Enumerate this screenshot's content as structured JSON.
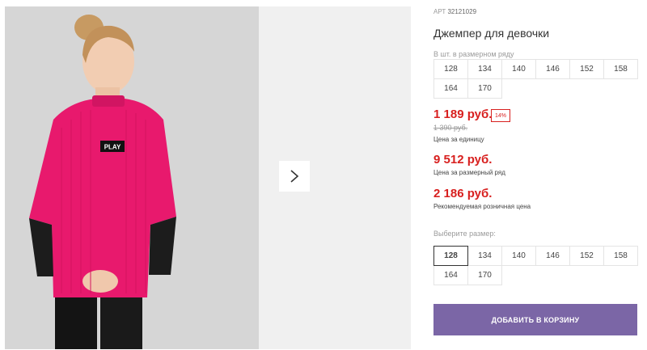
{
  "product": {
    "sku_label": "АРТ",
    "sku_number": "32121029",
    "title": "Джемпер для девочки",
    "badge_text": "PLAY"
  },
  "size_row": {
    "hint": "В шт. в размерном ряду",
    "sizes": [
      "128",
      "134",
      "140",
      "146",
      "152",
      "158",
      "164",
      "170"
    ]
  },
  "pricing": {
    "unit_price": "1 189 руб.",
    "discount": "14%",
    "old_price": "1 390 руб.",
    "unit_caption": "Цена за единицу",
    "row_price": "9 512 руб.",
    "row_caption": "Цена за размерный ряд",
    "retail_price": "2 186 руб.",
    "retail_caption": "Рекомендуемая розничная цена"
  },
  "size_select": {
    "hint": "Выберите размер:",
    "sizes": [
      "128",
      "134",
      "140",
      "146",
      "152",
      "158",
      "164",
      "170"
    ],
    "selected": "128"
  },
  "actions": {
    "add_to_cart": "ДОБАВИТЬ В КОРЗИНУ"
  },
  "colors": {
    "price_red": "#d8201f",
    "button_purple": "#7b66a6",
    "sweater_pink": "#e8196d"
  },
  "icons": {
    "next": "chevron-right-icon"
  }
}
